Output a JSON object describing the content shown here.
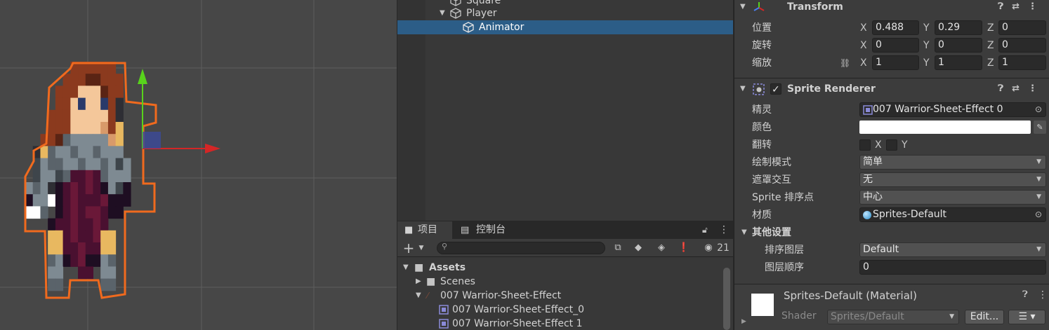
{
  "hierarchy": {
    "items": [
      {
        "label": "Square",
        "indent": 1,
        "selected": false
      },
      {
        "label": "Player",
        "indent": 1,
        "selected": false,
        "expanded": true
      },
      {
        "label": "Animator",
        "indent": 2,
        "selected": true
      }
    ]
  },
  "project": {
    "tab_project": "项目",
    "tab_console": "控制台",
    "visible_count": "21",
    "search_placeholder": "",
    "tree": [
      {
        "label": "Assets",
        "bold": true,
        "icon": "folder-icon"
      },
      {
        "label": "Scenes",
        "icon": "folder-icon"
      },
      {
        "label": "007 Warrior-Sheet-Effect",
        "icon": "texture-icon"
      },
      {
        "label": "007 Warrior-Sheet-Effect_0",
        "icon": "sprite-icon"
      },
      {
        "label": "007 Warrior-Sheet-Effect 1",
        "icon": "sprite-icon"
      }
    ]
  },
  "inspector": {
    "transform": {
      "title": "Transform",
      "position_label": "位置",
      "rotation_label": "旋转",
      "scale_label": "缩放",
      "position": {
        "x": "0.488",
        "y": "0.29",
        "z": "0"
      },
      "rotation": {
        "x": "0",
        "y": "0",
        "z": "0"
      },
      "scale": {
        "x": "1",
        "y": "1",
        "z": "1"
      },
      "axis_x": "X",
      "axis_y": "Y",
      "axis_z": "Z"
    },
    "sprite_renderer": {
      "title": "Sprite Renderer",
      "enabled": true,
      "sprite_label": "精灵",
      "sprite_value": "007 Warrior-Sheet-Effect 0",
      "color_label": "颜色",
      "color_value": "#ffffff",
      "flip_label": "翻转",
      "flip_x": "X",
      "flip_y": "Y",
      "draw_mode_label": "绘制模式",
      "draw_mode_value": "简单",
      "mask_label": "遮罩交互",
      "mask_value": "无",
      "sort_point_label": "Sprite 排序点",
      "sort_point_value": "中心",
      "material_label": "材质",
      "material_value": "Sprites-Default",
      "other_settings": "其他设置",
      "sorting_layer_label": "排序图层",
      "sorting_layer_value": "Default",
      "order_label": "图层顺序",
      "order_value": "0"
    },
    "material_footer": {
      "title": "Sprites-Default (Material)",
      "shader_label": "Shader",
      "shader_value": "Sprites/Default",
      "edit_button": "Edit..."
    }
  },
  "colors": {
    "selection": "#2c5d87",
    "outline": "#f06a1e",
    "gizmo_x": "#d42626",
    "gizmo_y": "#58d21c"
  }
}
